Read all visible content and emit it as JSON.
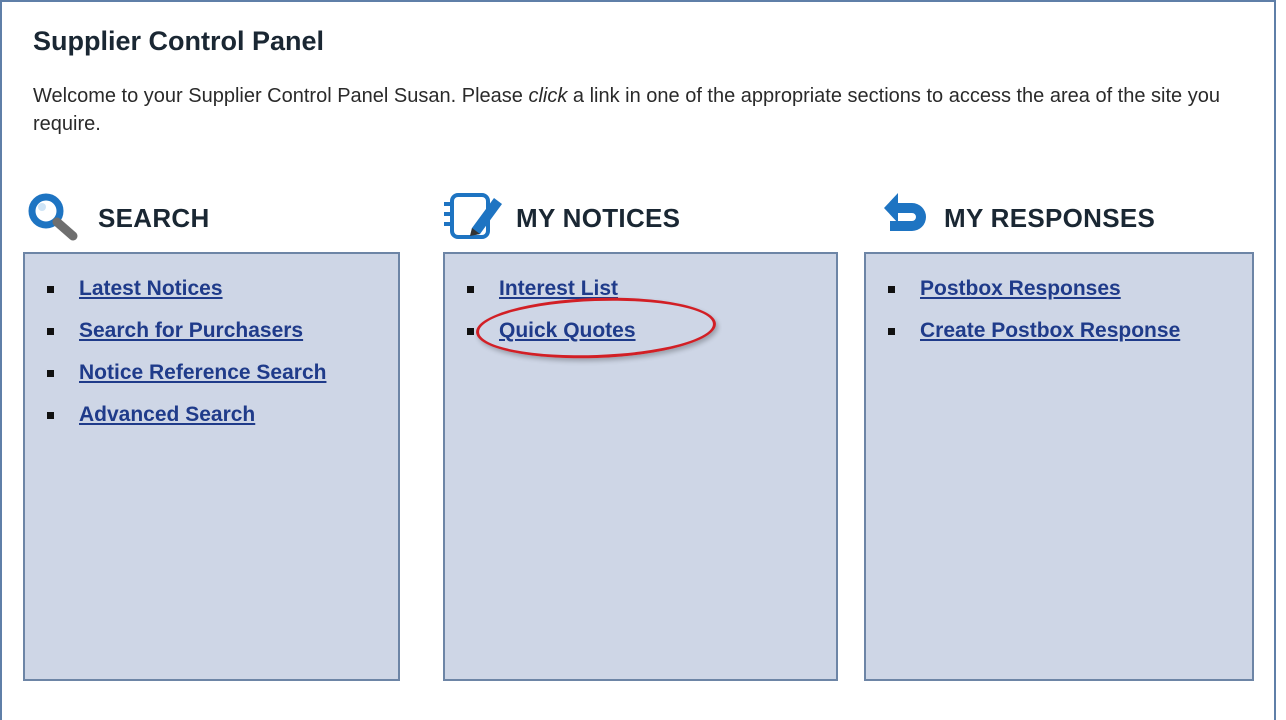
{
  "panel": {
    "title": "Supplier Control Panel",
    "intro_before": "Welcome to your Supplier Control Panel Susan. Please ",
    "intro_em": "click",
    "intro_after": " a link in one of the appropriate sections to access the area of the site you require."
  },
  "sections": [
    {
      "heading": "SEARCH",
      "icon": "magnifier-icon",
      "links": [
        "Latest Notices",
        "Search for Purchasers",
        "Notice Reference Search",
        "Advanced Search"
      ]
    },
    {
      "heading": "MY NOTICES",
      "icon": "notepad-pencil-icon",
      "links": [
        "Interest List",
        "Quick Quotes"
      ]
    },
    {
      "heading": "MY RESPONSES",
      "icon": "reply-arrow-icon",
      "links": [
        "Postbox Responses",
        "Create Postbox Response"
      ]
    }
  ],
  "annotation": {
    "highlighted_link": "Quick Quotes",
    "color": "#d21f25"
  },
  "colors": {
    "box_background": "#ced6e6",
    "box_border": "#6d85a6",
    "link": "#1f3b8a",
    "icon_blue": "#1e74c2"
  }
}
